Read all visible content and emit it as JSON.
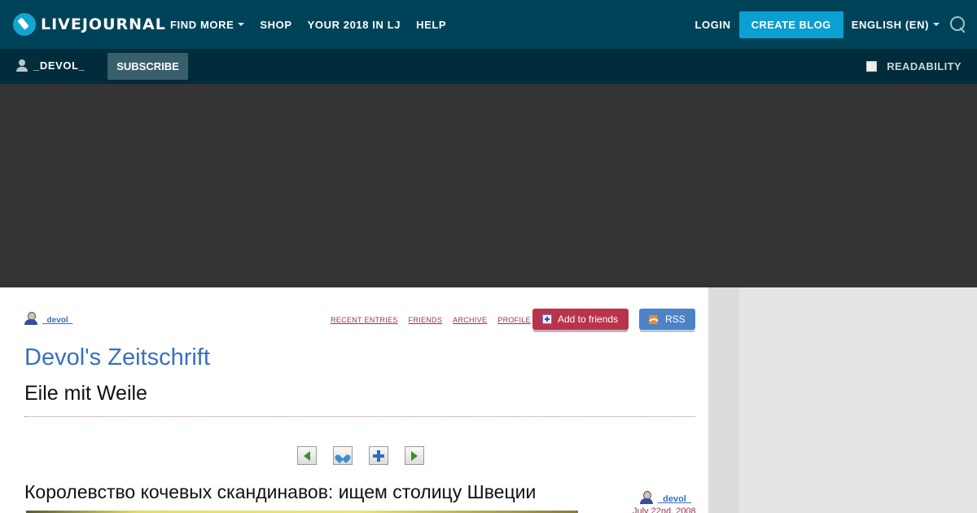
{
  "topbar": {
    "logo_text": "LIVEJOURNAL",
    "nav": [
      {
        "label": "FIND MORE",
        "has_dropdown": true
      },
      {
        "label": "SHOP",
        "has_dropdown": false
      },
      {
        "label": "YOUR 2018 IN LJ",
        "has_dropdown": false
      },
      {
        "label": "HELP",
        "has_dropdown": false
      }
    ],
    "login": "LOGIN",
    "create_blog": "CREATE BLOG",
    "language": "ENGLISH (EN)",
    "icons": {
      "search": "search-icon",
      "logo": "livejournal-logo-icon"
    },
    "colors": {
      "background": "#004359",
      "accent": "#0b9fd2"
    }
  },
  "subbar": {
    "username": "_DEVOL_",
    "subscribe": "SUBSCRIBE",
    "readability": "READABILITY",
    "readability_checked": false
  },
  "journal": {
    "user": "_devol_",
    "links": [
      "RECENT ENTRIES",
      "FRIENDS",
      "ARCHIVE",
      "PROFILE"
    ],
    "add_to_friends": "Add to friends",
    "rss": "RSS",
    "title": "Devol's Zeitschrift",
    "subtitle": "Eile mit Weile",
    "controls": [
      "previous-entry-icon",
      "memories-heart-icon",
      "add-tag-plus-icon",
      "next-entry-icon"
    ]
  },
  "post": {
    "title": "Королевство кочевых скандинавов: ищем столицу Швеции",
    "author": "_devol_",
    "date": "July 22nd, 2008"
  }
}
